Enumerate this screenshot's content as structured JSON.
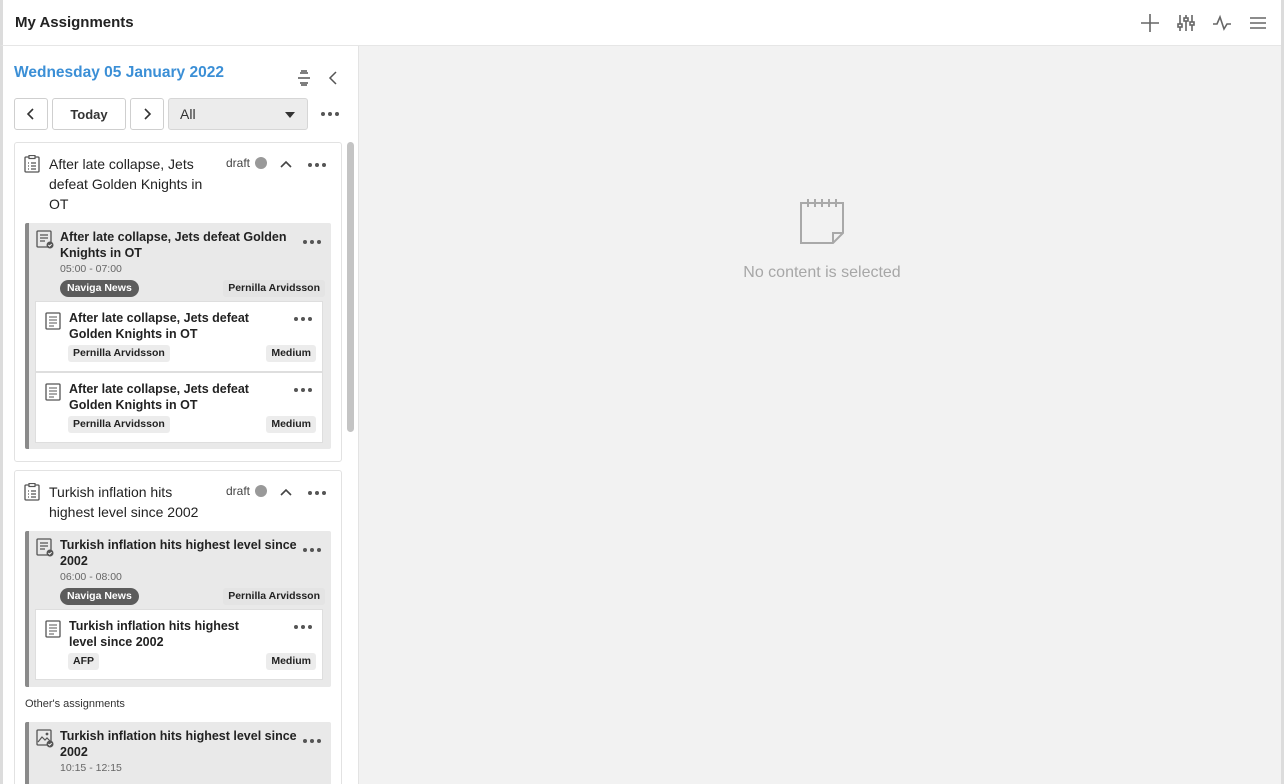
{
  "app": {
    "title": "My Assignments"
  },
  "toolbar": {
    "icons": [
      "plus-icon",
      "sliders-icon",
      "activity-icon",
      "menu-icon"
    ]
  },
  "planner": {
    "date": "Wednesday 05 January 2022",
    "today_label": "Today",
    "filter_value": "All"
  },
  "plans": [
    {
      "title": "After late collapse, Jets defeat Golden Knights in OT",
      "status": "draft",
      "assignments": [
        {
          "title": "After late collapse, Jets defeat Golden Knights in OT",
          "time": "05:00 - 07:00",
          "section": "Naviga News",
          "assignee": "Pernilla Arvidsson",
          "articles": [
            {
              "title": "After late collapse, Jets defeat Golden Knights in OT",
              "author": "Pernilla Arvidsson",
              "priority": "Medium"
            },
            {
              "title": "After late collapse, Jets defeat Golden Knights in OT",
              "author": "Pernilla Arvidsson",
              "priority": "Medium"
            }
          ]
        }
      ]
    },
    {
      "title": "Turkish inflation hits highest level since 2002",
      "status": "draft",
      "assignments": [
        {
          "title": "Turkish inflation hits highest level since 2002",
          "time": "06:00 - 08:00",
          "section": "Naviga News",
          "assignee": "Pernilla Arvidsson",
          "articles": [
            {
              "title": "Turkish inflation hits highest level since 2002",
              "author": "AFP",
              "priority": "Medium"
            }
          ]
        }
      ],
      "others_label": "Other's assignments",
      "others": [
        {
          "title": "Turkish inflation hits highest level since 2002",
          "time": "10:15 - 12:15"
        }
      ]
    }
  ],
  "empty_state": {
    "text": "No content is selected"
  },
  "colors": {
    "accent": "#3b8fd6",
    "badge": "#5c5c5c",
    "panel_bg": "#f2f2f2"
  }
}
